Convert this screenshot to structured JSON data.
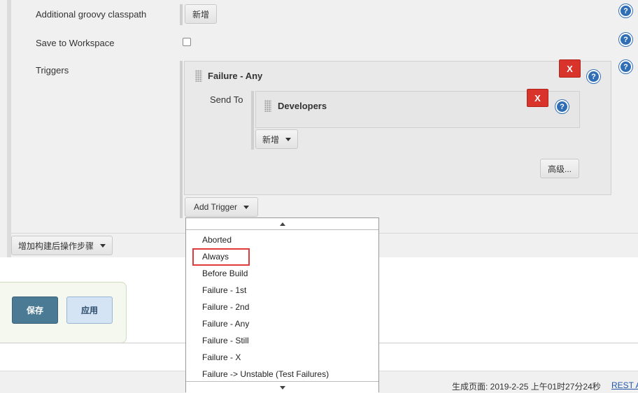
{
  "form": {
    "groovy_classpath_label": "Additional groovy classpath",
    "groovy_add_label": "新增",
    "save_to_workspace_label": "Save to Workspace",
    "triggers_label": "Triggers"
  },
  "trigger_card": {
    "title": "Failure - Any",
    "delete_label": "X",
    "send_to_label": "Send To",
    "recipient_title": "Developers",
    "recipient_delete_label": "X",
    "add_recipient_label": "新增",
    "advanced_label": "高级..."
  },
  "add_trigger_label": "Add Trigger",
  "add_post_build_label": "增加构建后操作步骤",
  "actions": {
    "save_label": "保存",
    "apply_label": "应用"
  },
  "trigger_dropdown": {
    "items": [
      "Aborted",
      "Always",
      "Before Build",
      "Failure - 1st",
      "Failure - 2nd",
      "Failure - Any",
      "Failure - Still",
      "Failure - X",
      "Failure -> Unstable (Test Failures)"
    ],
    "highlighted_item": "Always"
  },
  "footer": {
    "generated_text": "生成页面: 2019-2-25 上午01时27分24秒",
    "rest_link": "REST A"
  },
  "colors": {
    "save_button": "#4a7a94",
    "apply_button": "#d4e4f4",
    "delete_button": "#d9342b",
    "help_icon": "#2f6db5",
    "highlight_border": "#e03a3a"
  }
}
